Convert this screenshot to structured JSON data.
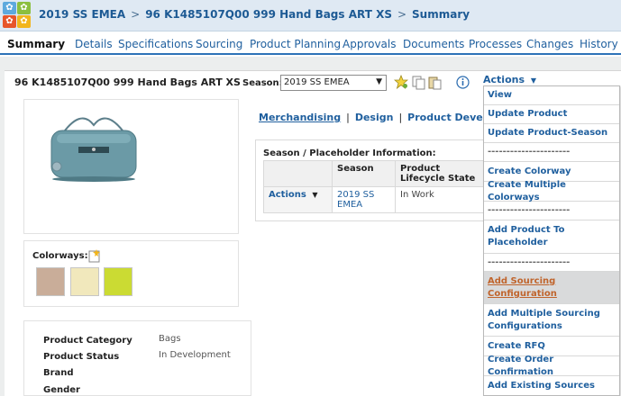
{
  "breadcrumb": {
    "season": "2019 SS EMEA",
    "product": "96 K1485107Q00 999 Hand Bags ART XS",
    "page": "Summary",
    "separator": ">"
  },
  "tabs": [
    "Summary",
    "Details",
    "Specifications",
    "Sourcing",
    "Product Planning",
    "Approvals",
    "Documents",
    "Processes",
    "Changes",
    "History"
  ],
  "product_title": "96 K1485107Q00 999 Hand Bags ART XS",
  "season_selector": {
    "label": "Season:",
    "value": "2019 SS EMEA"
  },
  "actions_label": "Actions",
  "section_links": [
    "Merchandising",
    "Design",
    "Product Developm"
  ],
  "season_info": {
    "title": "Season / Placeholder Information:",
    "headers": [
      "Season",
      "Product Lifecycle State"
    ],
    "row": {
      "actions": "Actions",
      "season": "2019 SS EMEA",
      "state": "In Work"
    }
  },
  "colorways": {
    "label": "Colorways:",
    "swatches": [
      "#c9ad99",
      "#f1e8bc",
      "#cbdb33"
    ]
  },
  "attributes": [
    {
      "label": "Product Category",
      "value": "Bags"
    },
    {
      "label": "Product Status",
      "value": "In Development"
    },
    {
      "label": "Brand",
      "value": ""
    },
    {
      "label": "Gender",
      "value": ""
    }
  ],
  "actions_menu": [
    {
      "label": "View"
    },
    {
      "label": "Update Product"
    },
    {
      "label": "Update Product-Season"
    },
    {
      "label": "----------------------"
    },
    {
      "label": "Create Colorway"
    },
    {
      "label": "Create Multiple Colorways"
    },
    {
      "label": "----------------------"
    },
    {
      "label": "Add Product To Placeholder"
    },
    {
      "label": "----------------------"
    },
    {
      "label": "Add Sourcing Configuration"
    },
    {
      "label": "Add Multiple Sourcing Configurations"
    },
    {
      "label": "Create RFQ"
    },
    {
      "label": "Create Order Confirmation"
    },
    {
      "label": "Add Existing Sources"
    }
  ]
}
